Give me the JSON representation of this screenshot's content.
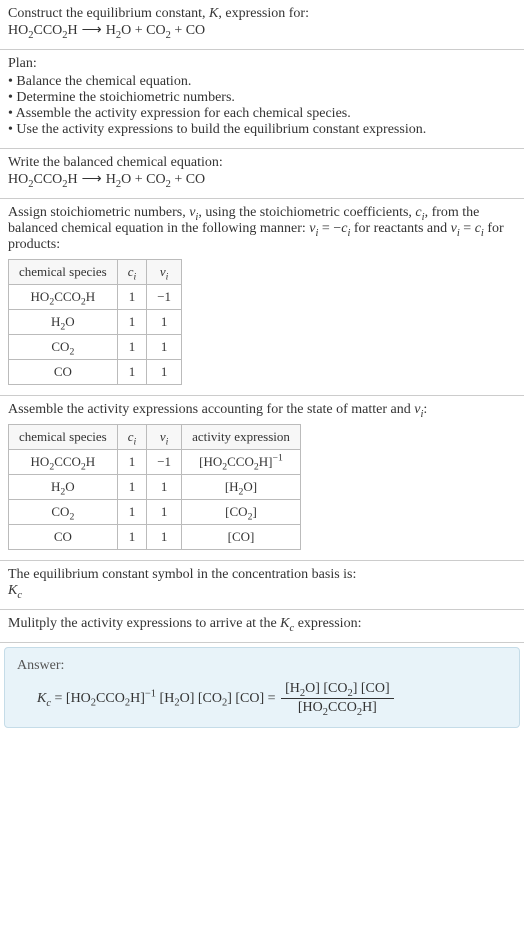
{
  "s1": {
    "line1": "Construct the equilibrium constant, K, expression for:",
    "eq": "HO₂CCO₂H  ⟶  H₂O + CO₂ + CO"
  },
  "s2": {
    "title": "Plan:",
    "items": [
      "Balance the chemical equation.",
      "Determine the stoichiometric numbers.",
      "Assemble the activity expression for each chemical species.",
      "Use the activity expressions to build the equilibrium constant expression."
    ]
  },
  "s3": {
    "line1": "Write the balanced chemical equation:",
    "eq": "HO₂CCO₂H  ⟶  H₂O + CO₂ + CO"
  },
  "s4": {
    "intro_a": "Assign stoichiometric numbers, νᵢ, using the stoichiometric coefficients, cᵢ, from the balanced chemical equation in the following manner: νᵢ = −cᵢ for reactants and νᵢ = cᵢ for products:",
    "headers": [
      "chemical species",
      "cᵢ",
      "νᵢ"
    ],
    "rows": [
      [
        "HO₂CCO₂H",
        "1",
        "−1"
      ],
      [
        "H₂O",
        "1",
        "1"
      ],
      [
        "CO₂",
        "1",
        "1"
      ],
      [
        "CO",
        "1",
        "1"
      ]
    ]
  },
  "s5": {
    "intro": "Assemble the activity expressions accounting for the state of matter and νᵢ:",
    "headers": [
      "chemical species",
      "cᵢ",
      "νᵢ",
      "activity expression"
    ],
    "rows": [
      [
        "HO₂CCO₂H",
        "1",
        "−1",
        "[HO₂CCO₂H]⁻¹"
      ],
      [
        "H₂O",
        "1",
        "1",
        "[H₂O]"
      ],
      [
        "CO₂",
        "1",
        "1",
        "[CO₂]"
      ],
      [
        "CO",
        "1",
        "1",
        "[CO]"
      ]
    ]
  },
  "s6": {
    "line1": "The equilibrium constant symbol in the concentration basis is:",
    "sym": "K_c"
  },
  "s7": {
    "line1": "Mulitply the activity expressions to arrive at the K_c expression:"
  },
  "ans": {
    "label": "Answer:",
    "lhs": "K_c = [HO₂CCO₂H]⁻¹ [H₂O] [CO₂] [CO] =",
    "num": "[H₂O] [CO₂] [CO]",
    "den": "[HO₂CCO₂H]"
  }
}
